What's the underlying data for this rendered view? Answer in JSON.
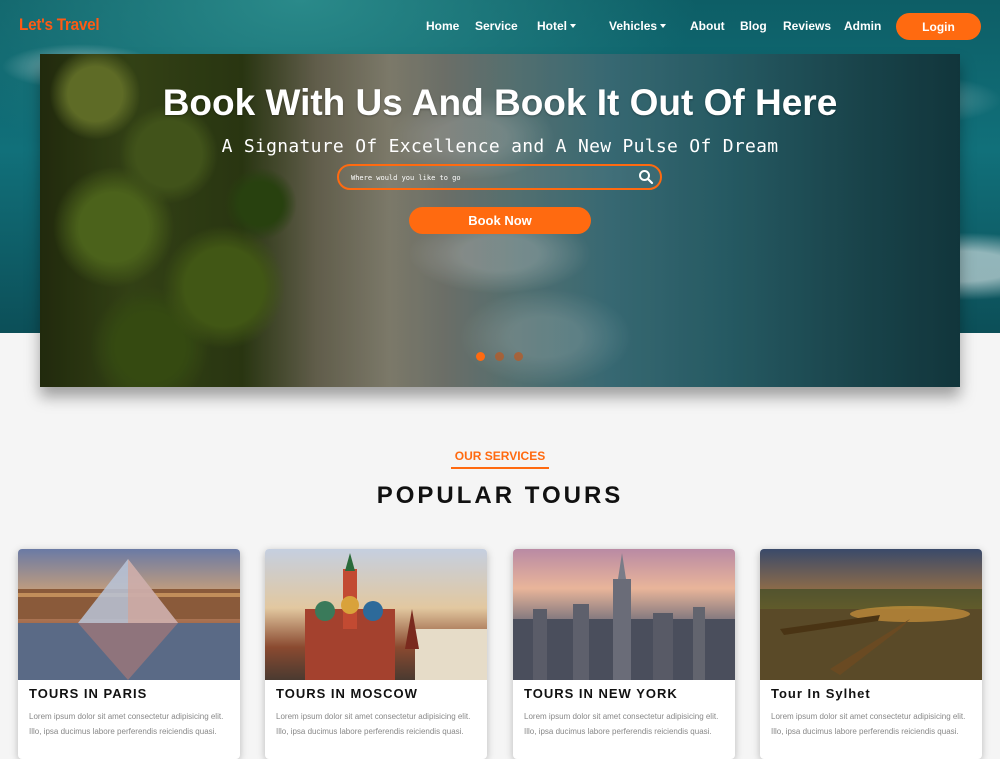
{
  "brand": "Let's Travel",
  "nav": {
    "home": "Home",
    "service": "Service",
    "hotel": "Hotel",
    "vehicles": "Vehicles",
    "about": "About",
    "blog": "Blog",
    "reviews": "Reviews",
    "admin": "Admin",
    "login": "Login"
  },
  "hero": {
    "title": "Book With Us And Book It Out Of Here",
    "subtitle": "A Signature Of Excellence and A New Pulse Of Dream",
    "search_placeholder": "Where would you like to go",
    "book_button": "Book Now",
    "slides": 3,
    "active_slide": 1
  },
  "services": {
    "label": "OUR SERVICES",
    "title": "POPULAR TOURS"
  },
  "tours": [
    {
      "title": "TOURS IN PARIS",
      "text": "Lorem ipsum dolor sit amet consectetur adipisicing elit. Illo, ipsa ducimus labore perferendis reiciendis quasi."
    },
    {
      "title": "TOURS IN MOSCOW",
      "text": "Lorem ipsum dolor sit amet consectetur adipisicing elit. Illo, ipsa ducimus labore perferendis reiciendis quasi."
    },
    {
      "title": "TOURS IN NEW YORK",
      "text": "Lorem ipsum dolor sit amet consectetur adipisicing elit. Illo, ipsa ducimus labore perferendis reiciendis quasi."
    },
    {
      "title": "Tour In Sylhet",
      "text": "Lorem ipsum dolor sit amet consectetur adipisicing elit. Illo, ipsa ducimus labore perferendis reiciendis quasi."
    }
  ],
  "colors": {
    "accent": "#ff6a10"
  }
}
